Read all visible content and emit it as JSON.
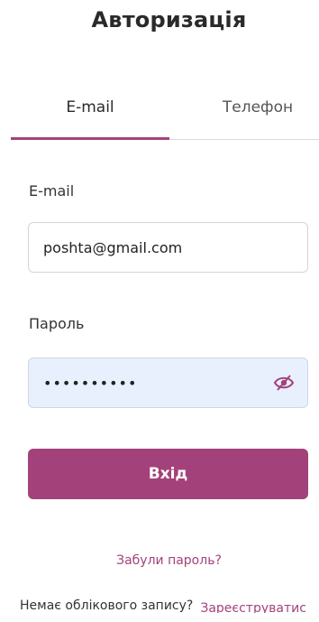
{
  "title": "Авторизація",
  "tabs": [
    {
      "label": "E-mail",
      "active": true
    },
    {
      "label": "Телефон",
      "active": false
    }
  ],
  "form": {
    "email_label": "E-mail",
    "email_value": "poshta@gmail.com",
    "password_label": "Пароль",
    "password_value": "••••••••••",
    "password_toggle_icon": "eye-off-icon",
    "submit_label": "Вхід"
  },
  "links": {
    "forgot_password": "Забули пароль?",
    "no_account": "Немає облікового запису?",
    "register": "Зареєструватис"
  },
  "colors": {
    "accent": "#a3427a",
    "autofill_bg": "#e8f0fe"
  }
}
